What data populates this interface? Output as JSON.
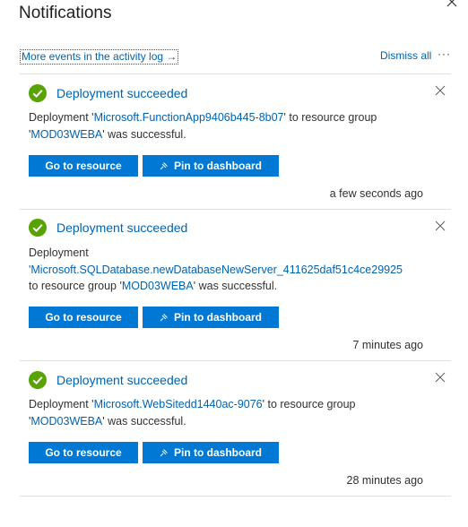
{
  "panel": {
    "title": "Notifications",
    "activity_link": "More events in the activity log",
    "activity_arrow": "→",
    "dismiss_all": "Dismiss all",
    "more": "···"
  },
  "notifications": [
    {
      "title": "Deployment succeeded",
      "line1_prefix": "Deployment '",
      "resource": "Microsoft.FunctionApp9406b445-8b07",
      "line1_suffix": "' to resource group",
      "line2_prefix": "'",
      "group": "MOD03WEBA",
      "line2_suffix": "' was successful.",
      "go_label": "Go to resource",
      "pin_label": "Pin to dashboard",
      "time": "a few seconds ago"
    },
    {
      "title": "Deployment succeeded",
      "line1": "Deployment",
      "resource": "'Microsoft.SQLDatabase.newDatabaseNewServer_411625daf51c4ce29925",
      "line3_prefix": " to resource group '",
      "group": "MOD03WEBA",
      "line3_suffix": "' was successful.",
      "go_label": "Go to resource",
      "pin_label": "Pin to dashboard",
      "time": "7 minutes ago"
    },
    {
      "title": "Deployment succeeded",
      "line1_prefix": "Deployment '",
      "resource": "Microsoft.WebSitedd1440ac-9076",
      "line1_suffix": "' to resource group",
      "line2_prefix": "'",
      "group": "MOD03WEBA",
      "line2_suffix": "' was successful.",
      "go_label": "Go to resource",
      "pin_label": "Pin to dashboard",
      "time": "28 minutes ago"
    }
  ],
  "icons": {
    "close": "close-icon",
    "success": "check-circle-icon",
    "pin": "pin-icon"
  },
  "colors": {
    "accent": "#0078d4",
    "link": "#0063b1",
    "success": "#57a300"
  }
}
